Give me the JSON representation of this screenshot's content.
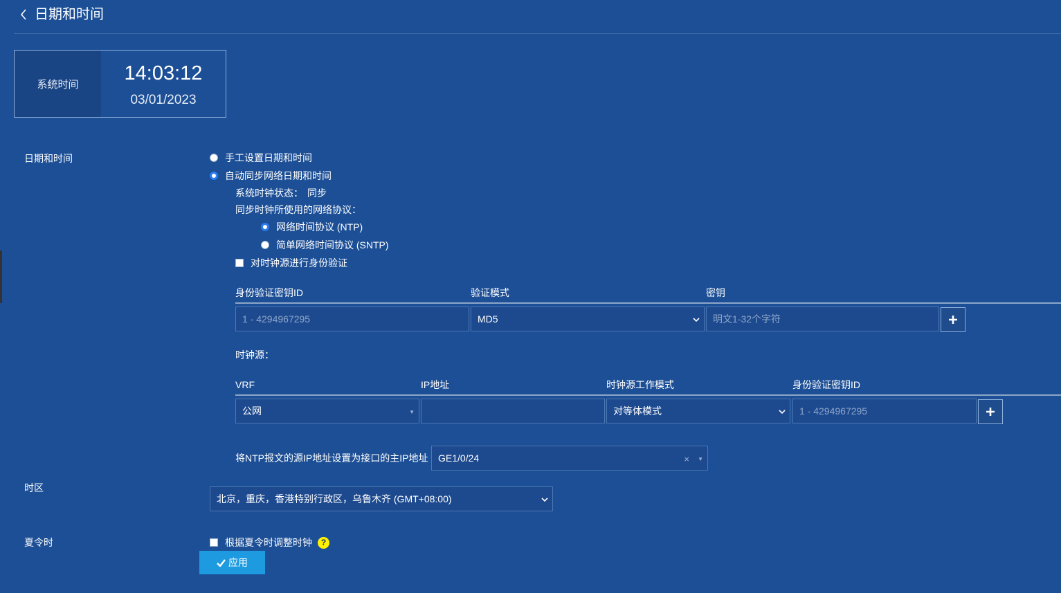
{
  "header": {
    "title": "日期和时间"
  },
  "system_time": {
    "label": "系统时间",
    "time": "14:03:12",
    "date": "03/01/2023"
  },
  "datetime": {
    "label": "日期和时间",
    "manual_option": "手工设置日期和时间",
    "auto_option": "自动同步网络日期和时间",
    "selected": "auto",
    "clock_status_label": "系统时钟状态：",
    "clock_status_value": "同步",
    "protocol_label": "同步时钟所使用的网络协议：",
    "ntp_option": "网络时间协议 (NTP)",
    "sntp_option": "简单网络时间协议 (SNTP)",
    "selected_protocol": "NTP",
    "auth_checkbox_label": "对时钟源进行身份验证",
    "auth_checked": false
  },
  "auth_table": {
    "columns": [
      "身份验证密钥ID",
      "验证模式",
      "密钥"
    ],
    "key_id_placeholder": "1 - 4294967295",
    "mode_value": "MD5",
    "key_placeholder": "明文1-32个字符"
  },
  "clock_source": {
    "label": "时钟源：",
    "columns": [
      "VRF",
      "IP地址",
      "时钟源工作模式",
      "身份验证密钥ID"
    ],
    "vrf_value": "公网",
    "ip_value": "",
    "mode_value": "对等体模式",
    "key_id_placeholder": "1 - 4294967295"
  },
  "source_ip": {
    "label": "将NTP报文的源IP地址设置为接口的主IP地址",
    "value": "GE1/0/24"
  },
  "timezone": {
    "label": "时区",
    "value": "北京，重庆，香港特别行政区，乌鲁木齐 (GMT+08:00)"
  },
  "dst": {
    "label": "夏令时",
    "checkbox_label": "根据夏令时调整时钟",
    "checked": false,
    "help": "?"
  },
  "apply_button": {
    "label": "应用"
  },
  "colors": {
    "background": "#1c4f96",
    "apply_button": "#1e9be0",
    "radio_selected": "#2b7cf2",
    "help_icon": "#fff200"
  }
}
